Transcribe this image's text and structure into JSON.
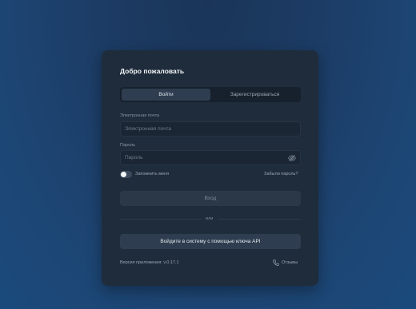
{
  "card": {
    "title": "Добро пожаловать",
    "tabs": [
      {
        "label": "Войти",
        "active": true
      },
      {
        "label": "Зарегистрироваться",
        "active": false
      }
    ],
    "email": {
      "label": "Электронная почта",
      "placeholder": "Электронная почта",
      "value": ""
    },
    "password": {
      "label": "Пароль",
      "placeholder": "Пароль",
      "value": ""
    },
    "remember_label": "Запомнить меня",
    "remember_on": false,
    "forgot_label": "Забыли пароль?",
    "login_button": "Вход",
    "or_label": "или",
    "api_button": "Войдите в систему с помощью ключа API",
    "version": "Версия приложения: v.0.17.1",
    "feedback": "Отзывы"
  },
  "colors": {
    "card_bg": "#1f2c3b",
    "accent_button": "#2e3d4f"
  },
  "icons": [
    "eye-slash-icon",
    "phone-icon"
  ]
}
